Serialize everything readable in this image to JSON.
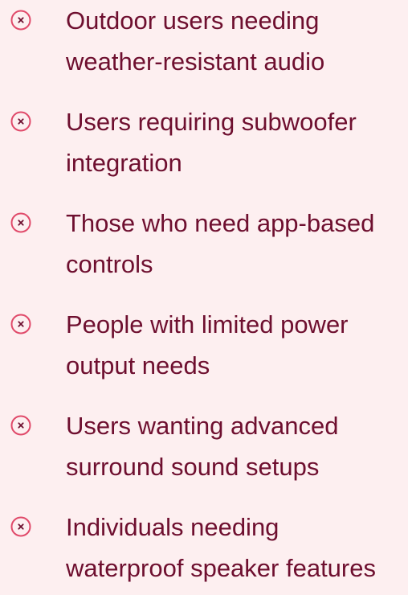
{
  "theme": {
    "background": "#fdeff0",
    "text_color": "#6e0f2f",
    "icon_color": "#e04a6a"
  },
  "not_for_list": {
    "items": [
      {
        "icon": "x-circle-icon",
        "line1": "Outdoor users needing",
        "line2": "weather-resistant audio"
      },
      {
        "icon": "x-circle-icon",
        "line1": "Users requiring subwoofer",
        "line2": "integration"
      },
      {
        "icon": "x-circle-icon",
        "line1": "Those who need app-based",
        "line2": "controls"
      },
      {
        "icon": "x-circle-icon",
        "line1": "People with limited power",
        "line2": "output needs"
      },
      {
        "icon": "x-circle-icon",
        "line1": "Users wanting advanced",
        "line2": "surround sound setups"
      },
      {
        "icon": "x-circle-icon",
        "line1": "Individuals needing",
        "line2": "waterproof speaker features"
      }
    ]
  }
}
